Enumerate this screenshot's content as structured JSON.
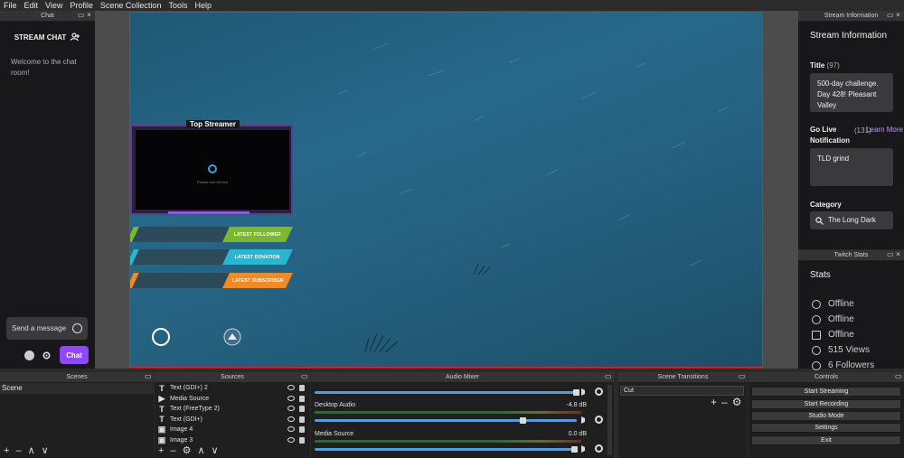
{
  "menu": [
    "File",
    "Edit",
    "View",
    "Profile",
    "Scene Collection",
    "Tools",
    "Help"
  ],
  "chat": {
    "dock_title": "Chat",
    "header": "STREAM CHAT",
    "welcome": "Welcome to the chat room!",
    "input_placeholder": "Send a message",
    "chat_button": "Chat"
  },
  "preview": {
    "webcam_title": "Top Streamer",
    "webcam_message": "Please turn WCam",
    "alerts": [
      {
        "label": "LATEST FOLLOWER",
        "color": "#7cb82f"
      },
      {
        "label": "LATEST DONATION",
        "color": "#2ab6d0"
      },
      {
        "label": "LATEST SUBSCRIBER",
        "color": "#f08a24"
      }
    ]
  },
  "info": {
    "dock_title": "Stream Information",
    "heading": "Stream Information",
    "title_label": "Title",
    "title_count": "(97)",
    "title_value": "500-day challenge. Day 428! Pleasant Valley",
    "golive_label": "Go Live Notification",
    "golive_count": "(131)",
    "learn_more": "Learn More",
    "golive_value": "TLD grind",
    "category_label": "Category",
    "category_value": "The Long Dark"
  },
  "stats": {
    "dock_title": "Twitch Stats",
    "heading": "Stats",
    "rows": [
      "Offline",
      "Offline",
      "Offline",
      "515 Views",
      "6 Followers"
    ]
  },
  "docks": {
    "scenes": "Scenes",
    "sources": "Sources",
    "mixer": "Audio Mixer",
    "transitions": "Scene Transitions",
    "controls": "Controls"
  },
  "scenes": [
    "Scene"
  ],
  "sources": [
    {
      "icon": "T",
      "name": "Text (GDI+) 2"
    },
    {
      "icon": "▶",
      "name": "Media Source"
    },
    {
      "icon": "T",
      "name": "Text (FreeType 2)"
    },
    {
      "icon": "T",
      "name": "Text (GDI+)"
    },
    {
      "icon": "▣",
      "name": "Image 4"
    },
    {
      "icon": "▣",
      "name": "Image 3"
    }
  ],
  "mixer": [
    {
      "name": "Desktop Audio",
      "db": "-4.8 dB",
      "level": 0.7
    },
    {
      "name": "Media Source",
      "db": "0.0 dB",
      "level": 1.0
    }
  ],
  "transitions": {
    "value": "Cut"
  },
  "controls": [
    "Start Streaming",
    "Start Recording",
    "Studio Mode",
    "Settings",
    "Exit"
  ]
}
